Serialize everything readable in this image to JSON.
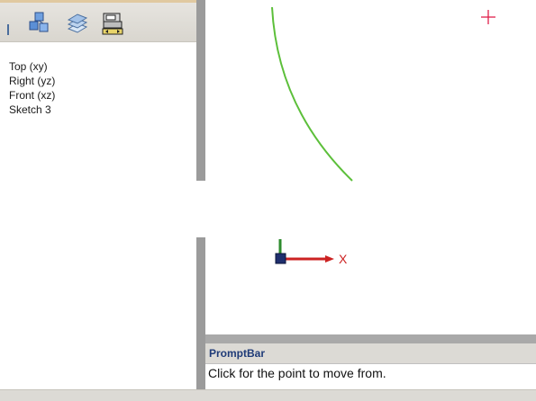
{
  "tree": {
    "toolbar_icons": [
      "feature-tree-icon",
      "layers-icon",
      "camera-icon"
    ],
    "items": [
      "Top (xy)",
      "Right (yz)",
      "Front (xz)",
      "Sketch 3"
    ]
  },
  "canvas": {
    "axis_label": "X",
    "colors": {
      "curve": "#5cbf3a",
      "x_axis": "#cc2222",
      "y_axis": "#2e8b2e",
      "cursor": "#e0204a"
    }
  },
  "prompt": {
    "title": "PromptBar",
    "message": "Click for the point to move from."
  }
}
